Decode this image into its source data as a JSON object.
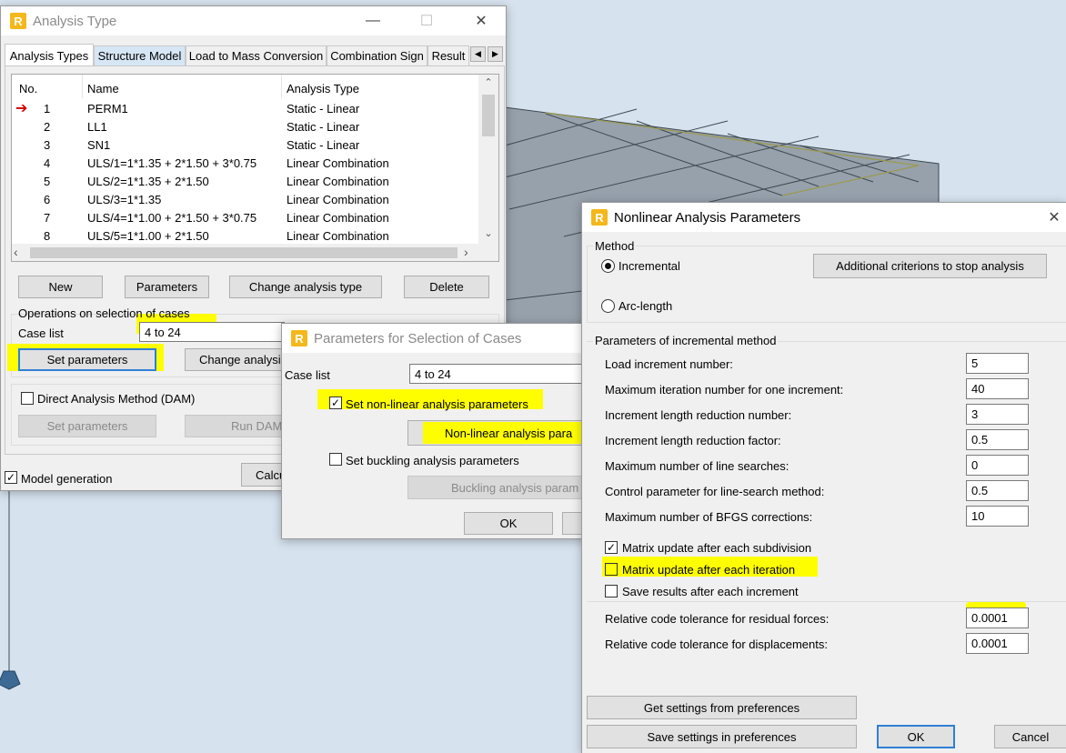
{
  "colors": {
    "highlight": "#fffe00",
    "focus_border": "#2f7fd6",
    "arrow": "#d00000"
  },
  "analysis_window": {
    "title": "Analysis Type",
    "tabs": [
      "Analysis Types",
      "Structure Model",
      "Load to Mass Conversion",
      "Combination Sign",
      "Result"
    ],
    "columns": [
      "No.",
      "Name",
      "Analysis Type"
    ],
    "rows": [
      {
        "no": "1",
        "name": "PERM1",
        "type": "Static - Linear"
      },
      {
        "no": "2",
        "name": "LL1",
        "type": "Static - Linear"
      },
      {
        "no": "3",
        "name": "SN1",
        "type": "Static - Linear"
      },
      {
        "no": "4",
        "name": "ULS/1=1*1.35 + 2*1.50 + 3*0.75",
        "type": "Linear Combination"
      },
      {
        "no": "5",
        "name": "ULS/2=1*1.35 + 2*1.50",
        "type": "Linear Combination"
      },
      {
        "no": "6",
        "name": "ULS/3=1*1.35",
        "type": "Linear Combination"
      },
      {
        "no": "7",
        "name": "ULS/4=1*1.00 + 2*1.50 + 3*0.75",
        "type": "Linear Combination"
      },
      {
        "no": "8",
        "name": "ULS/5=1*1.00 + 2*1.50",
        "type": "Linear Combination"
      }
    ],
    "buttons": {
      "new": "New",
      "parameters": "Parameters",
      "change_type": "Change analysis type",
      "delete": "Delete"
    },
    "operations_label": "Operations on selection of cases",
    "case_list_label": "Case list",
    "case_list_value": "4 to 24",
    "set_parameters": "Set parameters",
    "change_analysis": "Change analysis",
    "dam_label": "Direct Analysis Method (DAM)",
    "dam_set_parameters": "Set parameters",
    "run_dam": "Run DAM",
    "model_generation": "Model generation",
    "calculate": "Calcu"
  },
  "selection_window": {
    "title": "Parameters for Selection of Cases",
    "case_list_label": "Case list",
    "case_list_value": "4 to 24",
    "nonlinear_check": "Set non-linear analysis parameters",
    "nonlinear_button": "Non-linear analysis para",
    "buckling_check": "Set buckling analysis parameters",
    "buckling_button": "Buckling analysis param",
    "ok": "OK"
  },
  "nonlinear_window": {
    "title": "Nonlinear Analysis Parameters",
    "method_label": "Method",
    "incremental": "Incremental",
    "arc_length": "Arc-length",
    "additional_criteria": "Additional criterions to stop analysis",
    "params_label": "Parameters of incremental method",
    "params": [
      {
        "label": "Load increment number:",
        "value": "5"
      },
      {
        "label": "Maximum iteration number for one increment:",
        "value": "40"
      },
      {
        "label": "Increment length reduction number:",
        "value": "3"
      },
      {
        "label": "Increment length reduction factor:",
        "value": "0.5"
      },
      {
        "label": "Maximum number of line searches:",
        "value": "0"
      },
      {
        "label": "Control parameter for line-search method:",
        "value": "0.5"
      },
      {
        "label": "Maximum number of BFGS corrections:",
        "value": "10"
      }
    ],
    "matrix_subdivision": "Matrix update after each subdivision",
    "matrix_iteration": "Matrix update after each iteration",
    "save_results": "Save results after each increment",
    "tolerances": [
      {
        "label": "Relative code tolerance for residual forces:",
        "value": "0.0001"
      },
      {
        "label": "Relative code tolerance for displacements:",
        "value": "0.0001"
      }
    ],
    "get_settings": "Get settings from preferences",
    "save_settings": "Save settings in preferences",
    "ok": "OK",
    "cancel": "Cancel"
  }
}
